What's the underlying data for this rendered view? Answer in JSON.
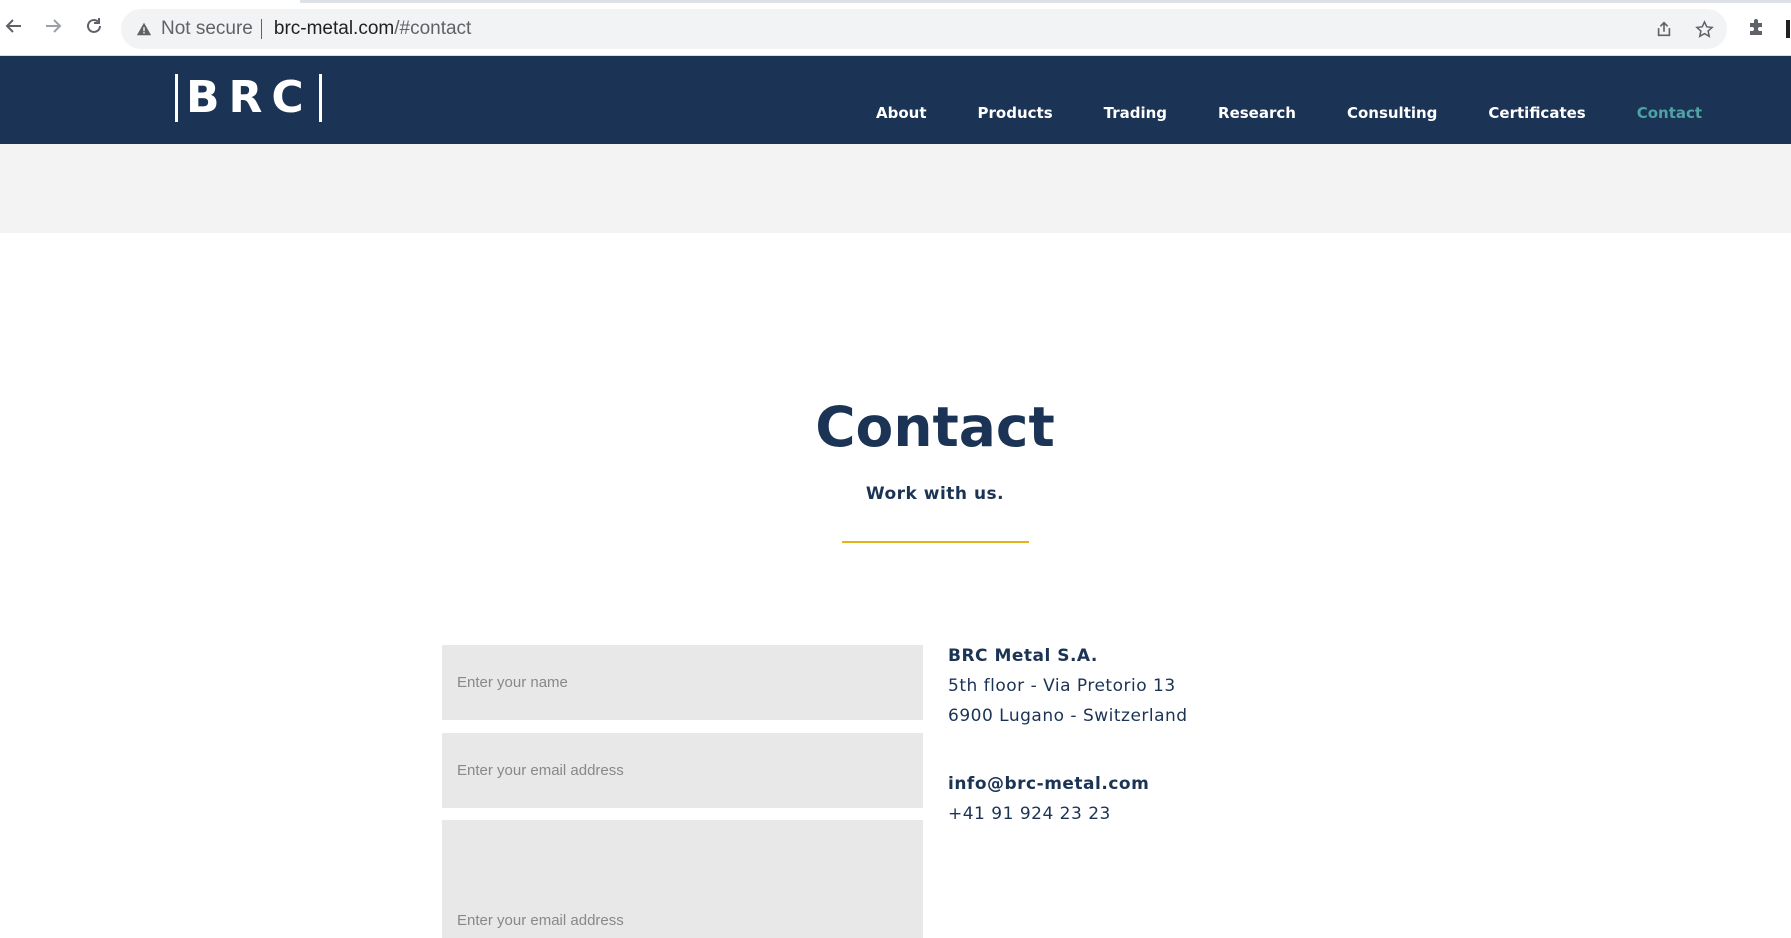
{
  "browser": {
    "security_label": "Not secure",
    "url_host": "brc-metal.com",
    "url_path": "/#contact"
  },
  "header": {
    "logo_text": "BRC",
    "nav": [
      {
        "label": "About",
        "active": false
      },
      {
        "label": "Products",
        "active": false
      },
      {
        "label": "Trading",
        "active": false
      },
      {
        "label": "Research",
        "active": false
      },
      {
        "label": "Consulting",
        "active": false
      },
      {
        "label": "Certificates",
        "active": false
      },
      {
        "label": "Contact",
        "active": true
      }
    ]
  },
  "contact": {
    "title": "Contact",
    "subtitle": "Work with us.",
    "form": {
      "name_placeholder": "Enter your name",
      "email_placeholder": "Enter your email address",
      "message_placeholder": "Enter your email address"
    },
    "company": "BRC Metal S.A.",
    "address_line1": "5th floor - Via Pretorio 13",
    "address_line2": "6900 Lugano - Switzerland",
    "email": "info@brc-metal.com",
    "phone": "+41 91 924 23 23"
  },
  "colors": {
    "header_bg": "#1b3354",
    "active_nav": "#4fa3a5",
    "accent_divider": "#e2b41b",
    "field_bg": "#e8e8e8"
  },
  "icons": [
    "back-arrow-icon",
    "forward-arrow-icon",
    "reload-icon",
    "warning-icon",
    "share-icon",
    "star-icon",
    "puzzle-icon"
  ]
}
